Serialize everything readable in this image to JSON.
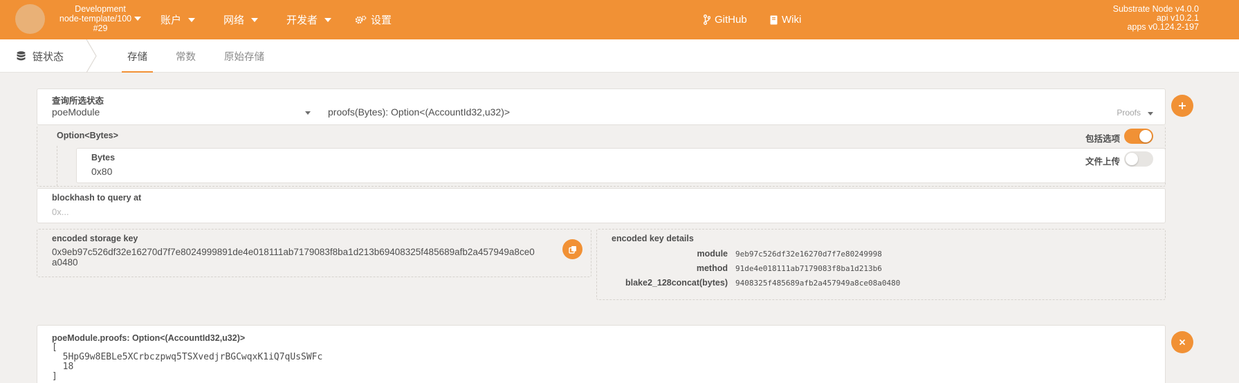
{
  "topbar": {
    "chain_name": "Development",
    "node": "node-template/100",
    "block": "#29",
    "menus": [
      {
        "label": "账户"
      },
      {
        "label": "网络"
      },
      {
        "label": "开发者"
      },
      {
        "label": "设置"
      }
    ],
    "links": [
      {
        "label": "GitHub"
      },
      {
        "label": "Wiki"
      }
    ],
    "version": {
      "node": "Substrate Node v4.0.0",
      "api": "api v10.2.1",
      "apps": "apps v0.124.2-197"
    }
  },
  "subnav": {
    "section": "链状态",
    "tabs": [
      {
        "label": "存储",
        "active": true
      },
      {
        "label": "常数",
        "active": false
      },
      {
        "label": "原始存储",
        "active": false
      }
    ]
  },
  "query": {
    "label": "查询所选状态",
    "module": "poeModule",
    "method": "proofs(Bytes): Option<(AccountId32,u32)>",
    "method_hint": "Proofs"
  },
  "param": {
    "type_label": "Option<Bytes>",
    "include_option_label": "包括选项",
    "include_option": true,
    "bytes_label": "Bytes",
    "bytes_value": "0x80",
    "file_upload_label": "文件上传",
    "file_upload": false
  },
  "blockhash": {
    "label": "blockhash to query at",
    "placeholder": "0x..."
  },
  "encoded_key": {
    "label": "encoded storage key",
    "value_line1": "0x9eb97c526df32e16270d7f7e8024999891de4e018111ab7179083f8ba1d213b69408325f485689afb2a457949a8ce0",
    "value_line2": "a0480"
  },
  "key_details": {
    "label": "encoded key details",
    "rows": [
      {
        "key": "module",
        "value": "9eb97c526df32e16270d7f7e80249998"
      },
      {
        "key": "method",
        "value": "91de4e018111ab7179083f8ba1d213b6"
      },
      {
        "key": "blake2_128concat(bytes)",
        "value": "9408325f485689afb2a457949a8ce08a0480"
      }
    ]
  },
  "result": {
    "label": "poeModule.proofs: Option<(AccountId32,u32)>",
    "lines": [
      "[",
      "  5HpG9w8EBLe5XCrbczpwq5TSXvedjrBGCwqxK1iQ7qUsSWFc",
      "  18",
      "]"
    ]
  },
  "colors": {
    "accent": "#f19135",
    "background": "#f2f0ee"
  },
  "icons": {
    "add": "plus-icon",
    "copy": "copy-icon",
    "close": "close-icon",
    "settings": "gear-icon",
    "github": "branch-icon",
    "wiki": "book-icon",
    "chain_state": "database-icon"
  }
}
